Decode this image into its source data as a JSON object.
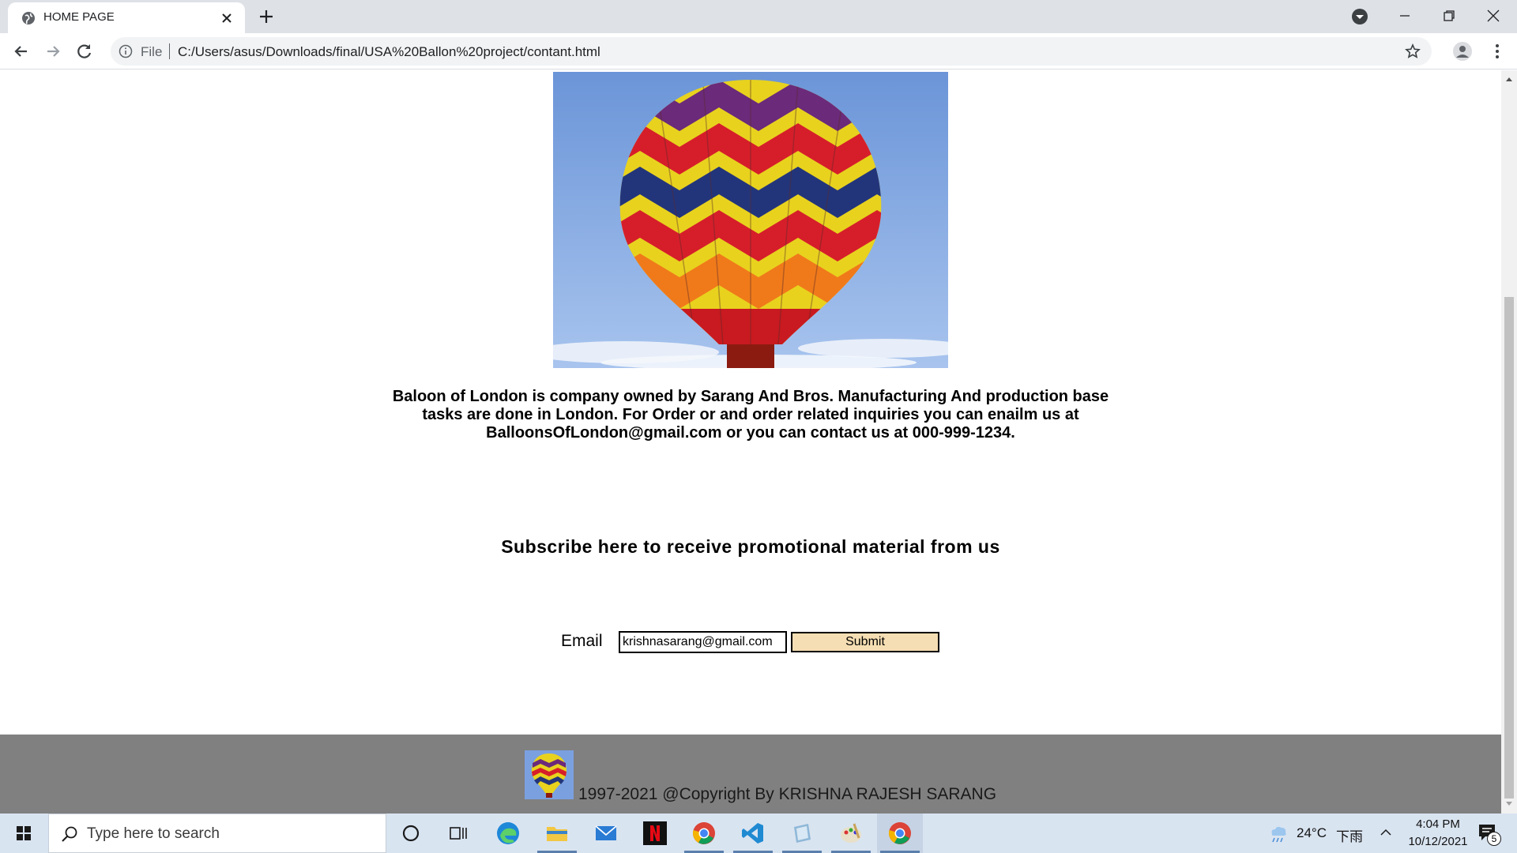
{
  "browser": {
    "tab_title": "HOME PAGE",
    "scheme_label": "File",
    "url": "C:/Users/asus/Downloads/final/USA%20Ballon%20project/contant.html"
  },
  "page": {
    "about_text": "Baloon of London is company owned by Sarang And Bros. Manufacturing And production base tasks are done in London. For Order or and order related inquiries you can enailm us at BalloonsOfLondon@gmail.com or you can contact us at 000-999-1234.",
    "subscribe_title": "Subscribe here to receive promotional material from us",
    "email_label": "Email",
    "email_value": "krishnasarang@gmail.com",
    "submit_label": "Submit",
    "footer_text": "1997-2021 @Copyright By KRISHNA RAJESH SARANG"
  },
  "taskbar": {
    "search_placeholder": "Type here to search",
    "weather": "24°C",
    "weather_condition": "下雨",
    "time": "4:04 PM",
    "date": "10/12/2021",
    "notification_count": "5"
  },
  "colors": {
    "submit_bg": "#f5deb3",
    "footer_bg": "#808080",
    "taskbar_bg": "#d9e4f1"
  }
}
